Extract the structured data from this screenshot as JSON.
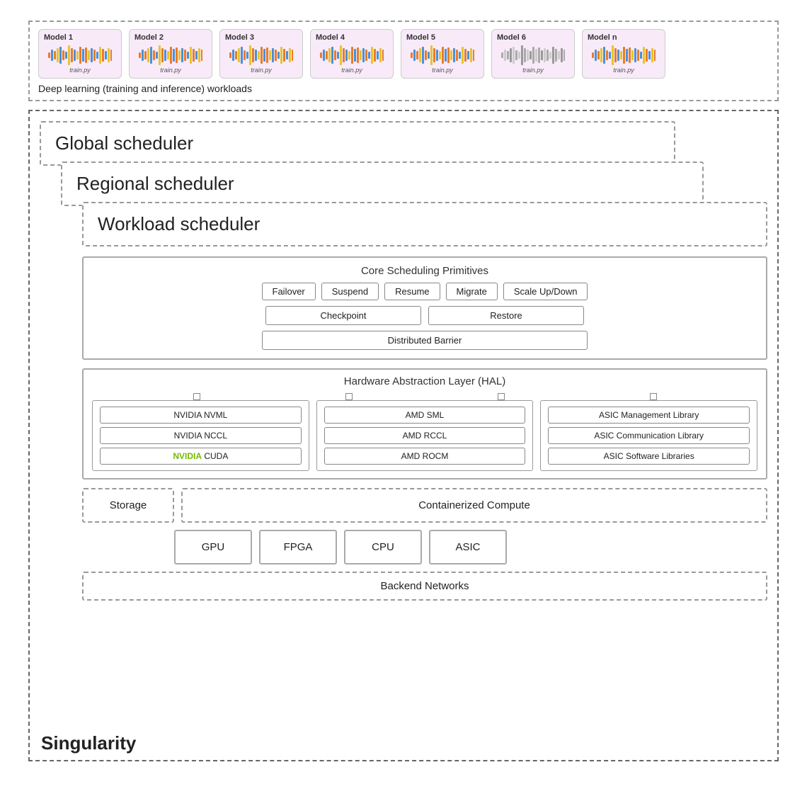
{
  "workloads": {
    "label": "Deep learning (training and inference) workloads",
    "models": [
      {
        "title": "Model 1",
        "script": "train.py",
        "colors": [
          "#e87c2a",
          "#4a90d9",
          "#e8c42a"
        ]
      },
      {
        "title": "Model 2",
        "script": "train.py",
        "colors": [
          "#e87c2a",
          "#4a90d9",
          "#e8c42a"
        ]
      },
      {
        "title": "Model 3",
        "script": "train.py",
        "colors": [
          "#e87c2a",
          "#4a90d9",
          "#e8c42a"
        ]
      },
      {
        "title": "Model 4",
        "script": "train.py",
        "colors": [
          "#e87c2a",
          "#4a90d9",
          "#e8c42a"
        ]
      },
      {
        "title": "Model 5",
        "script": "train.py",
        "colors": [
          "#e87c2a",
          "#4a90d9",
          "#e8c42a"
        ]
      },
      {
        "title": "Model 6",
        "script": "train.py",
        "colors": [
          "#aaa",
          "#ccc",
          "#999"
        ]
      },
      {
        "title": "Model n",
        "script": "train.py",
        "colors": [
          "#e87c2a",
          "#4a90d9",
          "#e8c42a"
        ]
      }
    ]
  },
  "schedulers": {
    "global": "Global scheduler",
    "regional": "Regional scheduler",
    "workload": "Workload scheduler"
  },
  "core_scheduling": {
    "title": "Core Scheduling Primitives",
    "primitives": [
      "Failover",
      "Suspend",
      "Resume",
      "Migrate",
      "Scale Up/Down"
    ],
    "checkpoint": "Checkpoint",
    "restore": "Restore",
    "distributed_barrier": "Distributed Barrier"
  },
  "hal": {
    "title": "Hardware Abstraction Layer (HAL)",
    "nvidia": {
      "items": [
        "NVIDIA NVML",
        "NVIDIA NCCL",
        "NVIDIA CUDA"
      ]
    },
    "amd": {
      "items": [
        "AMD SML",
        "AMD RCCL",
        "AMD ROCM"
      ]
    },
    "asic": {
      "items": [
        "ASIC Management Library",
        "ASIC Communication Library",
        "ASIC Software Libraries"
      ]
    }
  },
  "storage": "Storage",
  "containerized": "Containerized Compute",
  "compute_units": [
    "GPU",
    "FPGA",
    "CPU",
    "ASIC"
  ],
  "backend_networks": "Backend Networks",
  "brand": "Singularity"
}
